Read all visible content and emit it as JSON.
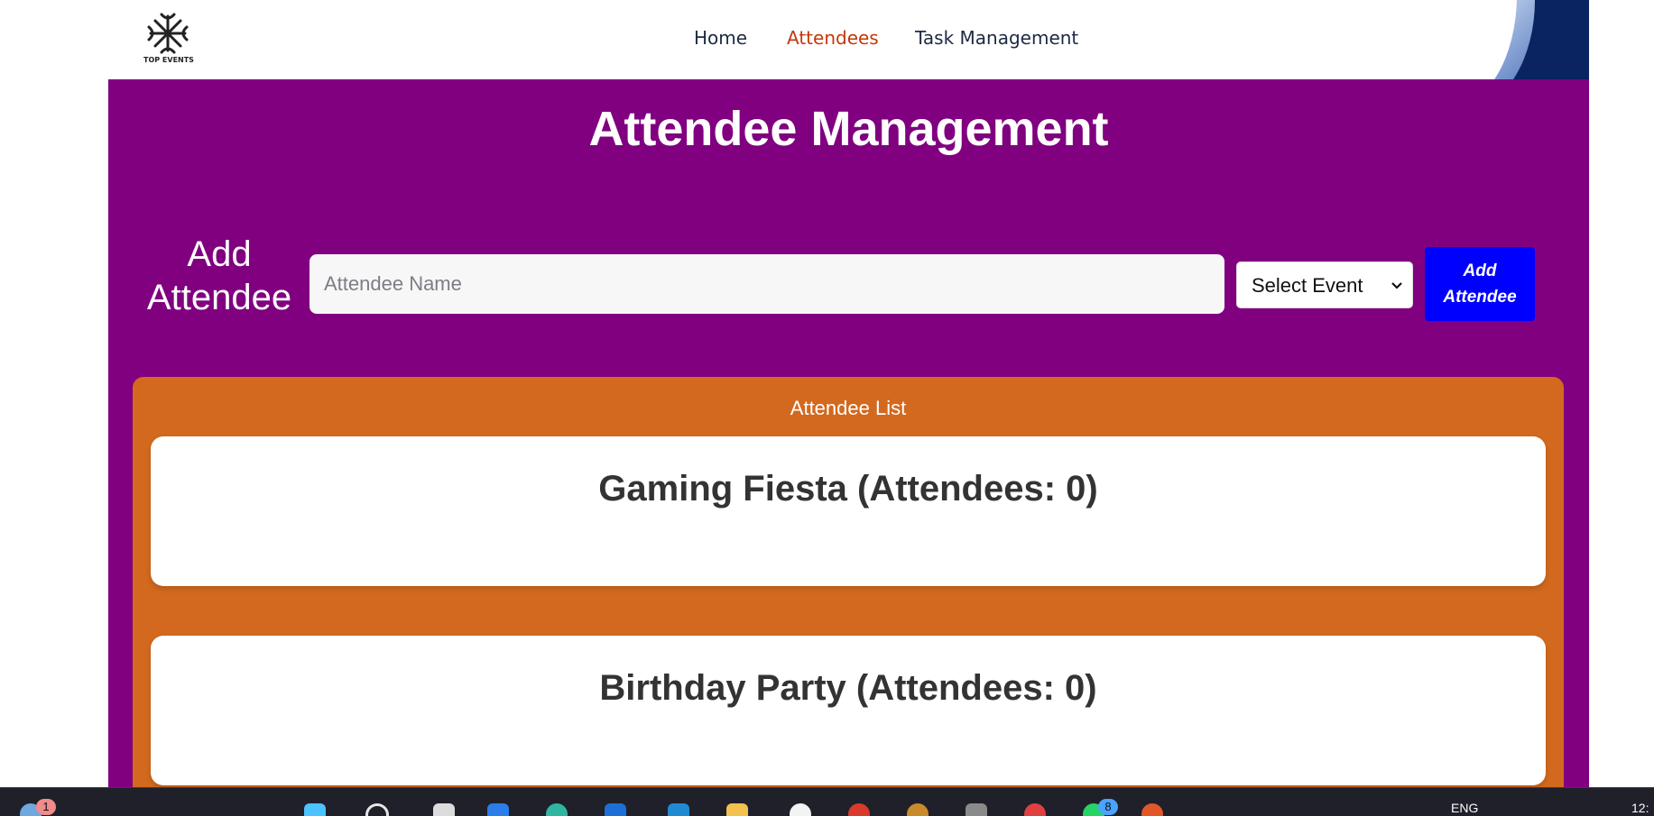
{
  "brand": {
    "logo_text": "TOP EVENTS"
  },
  "nav": {
    "home": "Home",
    "attendees": "Attendees",
    "tasks": "Task Management"
  },
  "main": {
    "title": "Attendee Management",
    "add_label": "Add Attendee",
    "name_placeholder": "Attendee Name",
    "event_select_value": "Select Event",
    "add_button": "Add Attendee"
  },
  "list": {
    "title": "Attendee List",
    "events": [
      {
        "title": "Gaming Fiesta (Attendees: 0)"
      },
      {
        "title": "Birthday Party (Attendees: 0)"
      }
    ]
  },
  "taskbar": {
    "weather_badge": "1",
    "whatsapp_badge": "8",
    "language": "ENG",
    "clock": "12:"
  },
  "colors": {
    "main_bg": "#800080",
    "list_bg": "#d2691e",
    "button_bg": "#0000ff",
    "nav_active": "#c4380b"
  }
}
